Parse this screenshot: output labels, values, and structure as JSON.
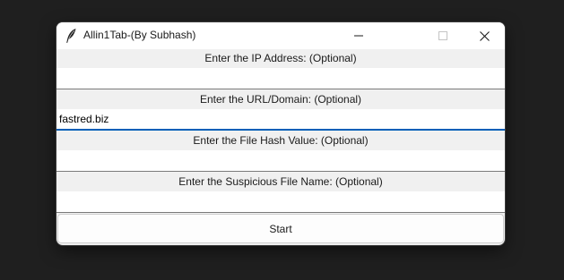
{
  "window": {
    "title": "Allin1Tab-(By Subhash)",
    "icon": "feather-icon"
  },
  "titlebar_controls": {
    "minimize_icon": "minimize-icon",
    "maximize_icon": "maximize-icon",
    "close_icon": "close-icon"
  },
  "fields": [
    {
      "label": "Enter the IP Address: (Optional)",
      "value": "",
      "focused": false
    },
    {
      "label": "Enter the URL/Domain: (Optional)",
      "value": "fastred.biz",
      "focused": true
    },
    {
      "label": "Enter the File Hash Value: (Optional)",
      "value": "",
      "focused": false
    },
    {
      "label": "Enter the Suspicious File Name: (Optional)",
      "value": "",
      "focused": false
    }
  ],
  "start_button": {
    "label": "Start"
  },
  "colors": {
    "focus_accent": "#005fb8",
    "window_background": "#f0f0f0",
    "desktop_background": "#1f1f1f"
  }
}
